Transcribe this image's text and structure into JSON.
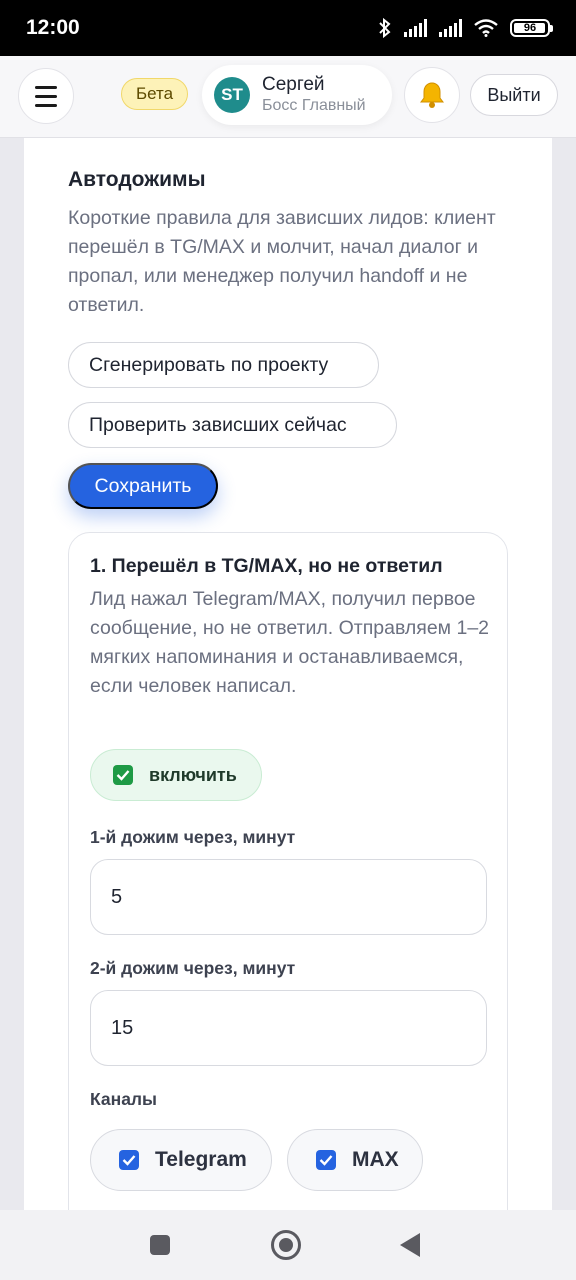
{
  "status_bar": {
    "time": "12:00",
    "battery": "96",
    "icons": [
      "bluetooth-icon",
      "signal-icon",
      "signal-icon",
      "wifi-icon",
      "battery-icon"
    ]
  },
  "header": {
    "menu_icon": "hamburger-menu-icon",
    "beta_label": "Бета",
    "avatar_initials": "ST",
    "user_name": "Сергей",
    "user_role": "Босс Главный",
    "notifications_icon": "bell-icon",
    "logout_label": "Выйти"
  },
  "section": {
    "title": "Автодожимы",
    "description": "Короткие правила для зависших лидов: клиент перешёл в TG/MAX и молчит, начал диалог и пропал, или менеджер получил handoff и не ответил.",
    "generate_label": "Сгенерировать по проекту",
    "check_label": "Проверить зависших сейчас",
    "save_label": "Сохранить"
  },
  "rule": {
    "title": "1. Перешёл в TG/MAX, но не ответил",
    "description": "Лид нажал Telegram/MAX, получил первое сообщение, но не ответил. Отправляем 1–2 мягких напоминания и останавливаемся, если человек написал.",
    "enable_label": "включить",
    "enabled": true,
    "first_label": "1-й дожим через, минут",
    "first_value": "5",
    "second_label": "2-й дожим через, минут",
    "second_value": "15",
    "channels_label": "Каналы",
    "channels": [
      {
        "label": "Telegram",
        "checked": true
      },
      {
        "label": "MAX",
        "checked": true
      }
    ]
  },
  "colors": {
    "accent": "#2563e0",
    "enabled_green": "#1e9a45",
    "beta_yellow": "#fdf2b8",
    "avatar_teal": "#1f8c8c"
  },
  "nav_bar": {
    "icons": [
      "recent-apps-icon",
      "home-icon",
      "back-icon"
    ]
  }
}
